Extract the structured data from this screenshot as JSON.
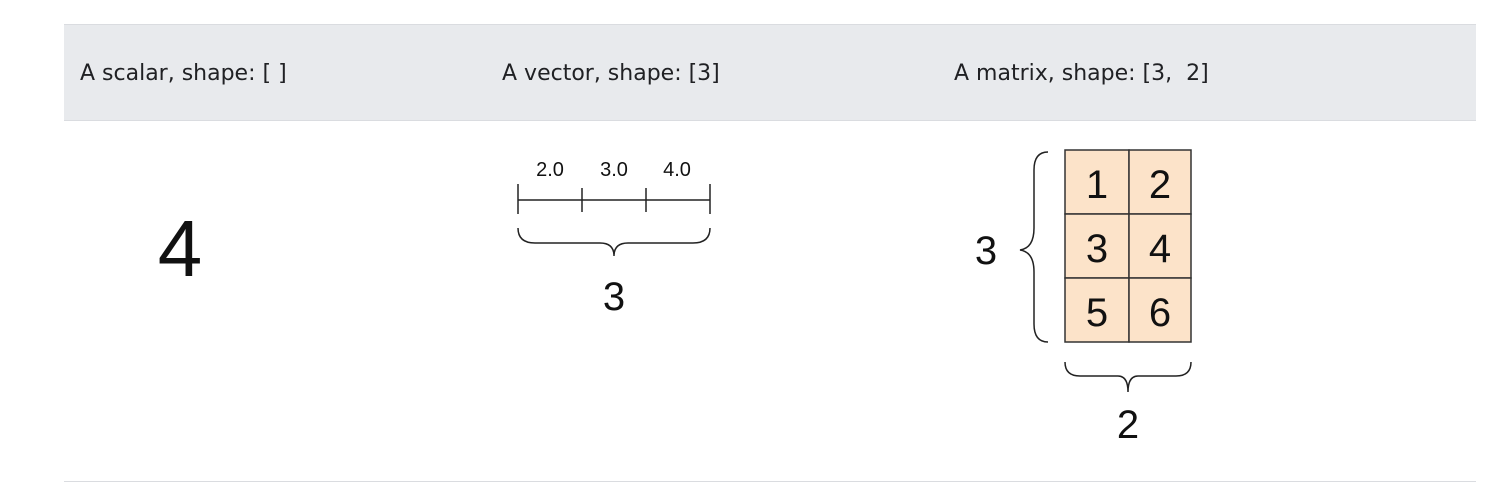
{
  "headers": {
    "scalar": "A scalar, shape: [ ]",
    "vector": "A vector, shape: [3]",
    "matrix": "A matrix, shape: [3,  2]"
  },
  "scalar": {
    "value": "4"
  },
  "vector": {
    "values": [
      "2.0",
      "3.0",
      "4.0"
    ],
    "length": "3"
  },
  "matrix": {
    "rows": "3",
    "cols": "2",
    "cells": [
      [
        "1",
        "2"
      ],
      [
        "3",
        "4"
      ],
      [
        "5",
        "6"
      ]
    ],
    "cell_color": "#fce3c9",
    "border_color": "#333333"
  }
}
